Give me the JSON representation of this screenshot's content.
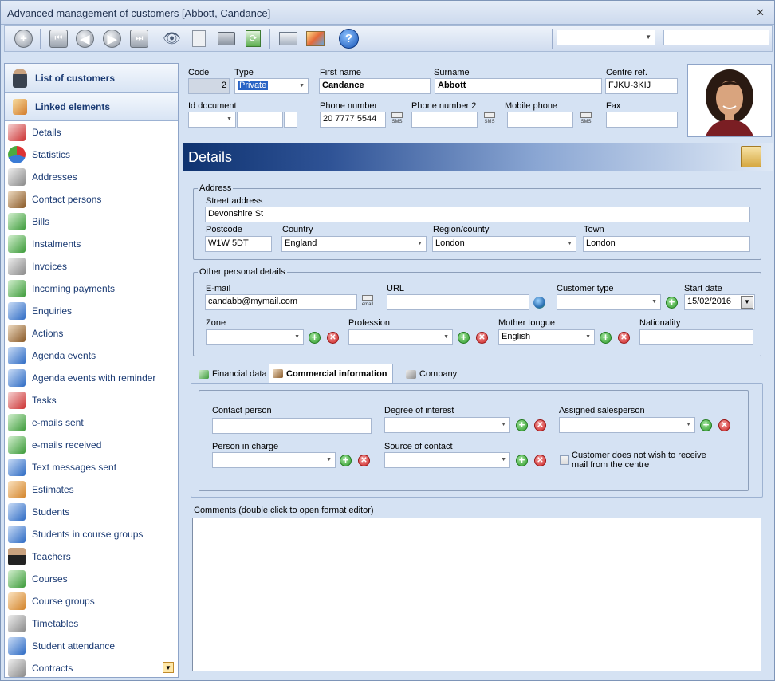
{
  "window": {
    "title": "Advanced management of customers [Abbott, Candance]"
  },
  "sidebar": {
    "header_list": "List of customers",
    "header_linked": "Linked elements",
    "items": [
      {
        "label": "Details",
        "icon": "details-icon"
      },
      {
        "label": "Statistics",
        "icon": "statistics-icon"
      },
      {
        "label": "Addresses",
        "icon": "addresses-icon"
      },
      {
        "label": "Contact persons",
        "icon": "contact-persons-icon"
      },
      {
        "label": "Bills",
        "icon": "bills-icon"
      },
      {
        "label": "Instalments",
        "icon": "instalments-icon"
      },
      {
        "label": "Invoices",
        "icon": "invoices-icon"
      },
      {
        "label": "Incoming payments",
        "icon": "incoming-payments-icon"
      },
      {
        "label": "Enquiries",
        "icon": "enquiries-icon"
      },
      {
        "label": "Actions",
        "icon": "actions-icon"
      },
      {
        "label": "Agenda events",
        "icon": "agenda-events-icon"
      },
      {
        "label": "Agenda events with reminder",
        "icon": "agenda-reminder-icon"
      },
      {
        "label": "Tasks",
        "icon": "tasks-icon"
      },
      {
        "label": "e-mails sent",
        "icon": "emails-sent-icon"
      },
      {
        "label": "e-mails received",
        "icon": "emails-received-icon"
      },
      {
        "label": "Text messages sent",
        "icon": "text-messages-icon"
      },
      {
        "label": "Estimates",
        "icon": "estimates-icon"
      },
      {
        "label": "Students",
        "icon": "students-icon"
      },
      {
        "label": "Students in course groups",
        "icon": "students-groups-icon"
      },
      {
        "label": "Teachers",
        "icon": "teachers-icon"
      },
      {
        "label": "Courses",
        "icon": "courses-icon"
      },
      {
        "label": "Course groups",
        "icon": "course-groups-icon"
      },
      {
        "label": "Timetables",
        "icon": "timetables-icon"
      },
      {
        "label": "Student attendance",
        "icon": "attendance-icon"
      },
      {
        "label": "Contracts",
        "icon": "contracts-icon"
      }
    ]
  },
  "header_form": {
    "code_label": "Code",
    "code_value": "2",
    "type_label": "Type",
    "type_value": "Private",
    "first_name_label": "First name",
    "first_name_value": "Candance",
    "surname_label": "Surname",
    "surname_value": "Abbott",
    "centre_ref_label": "Centre ref.",
    "centre_ref_value": "FJKU-3KIJ",
    "id_document_label": "Id document",
    "phone_label": "Phone number",
    "phone_value": "20 7777 5544",
    "phone2_label": "Phone number 2",
    "mobile_label": "Mobile phone",
    "fax_label": "Fax",
    "sms_label": "SMS"
  },
  "details": {
    "title": "Details",
    "address_group": "Address",
    "street_label": "Street address",
    "street_value": "Devonshire St",
    "postcode_label": "Postcode",
    "postcode_value": "W1W 5DT",
    "country_label": "Country",
    "country_value": "England",
    "region_label": "Region/county",
    "region_value": "London",
    "town_label": "Town",
    "town_value": "London",
    "other_group": "Other personal details",
    "email_label": "E-mail",
    "email_value": "candabb@mymail.com",
    "email_button": "email",
    "url_label": "URL",
    "customer_type_label": "Customer type",
    "start_date_label": "Start date",
    "start_date_value": "15/02/2016",
    "zone_label": "Zone",
    "profession_label": "Profession",
    "mother_tongue_label": "Mother tongue",
    "mother_tongue_value": "English",
    "nationality_label": "Nationality"
  },
  "tabs": {
    "financial": "Financial data",
    "commercial": "Commercial information",
    "company": "Company"
  },
  "commercial": {
    "contact_person_label": "Contact person",
    "degree_label": "Degree of interest",
    "salesperson_label": "Assigned salesperson",
    "person_in_charge_label": "Person in charge",
    "source_label": "Source of contact",
    "no_mail_line1": "Customer does not wish to receive",
    "no_mail_line2": "mail from the centre"
  },
  "comments": {
    "label": "Comments (double click to open format editor)"
  },
  "colors": {
    "accent": "#1a3a73",
    "header_dark": "#0f3370",
    "background": "#d5e2f3"
  }
}
